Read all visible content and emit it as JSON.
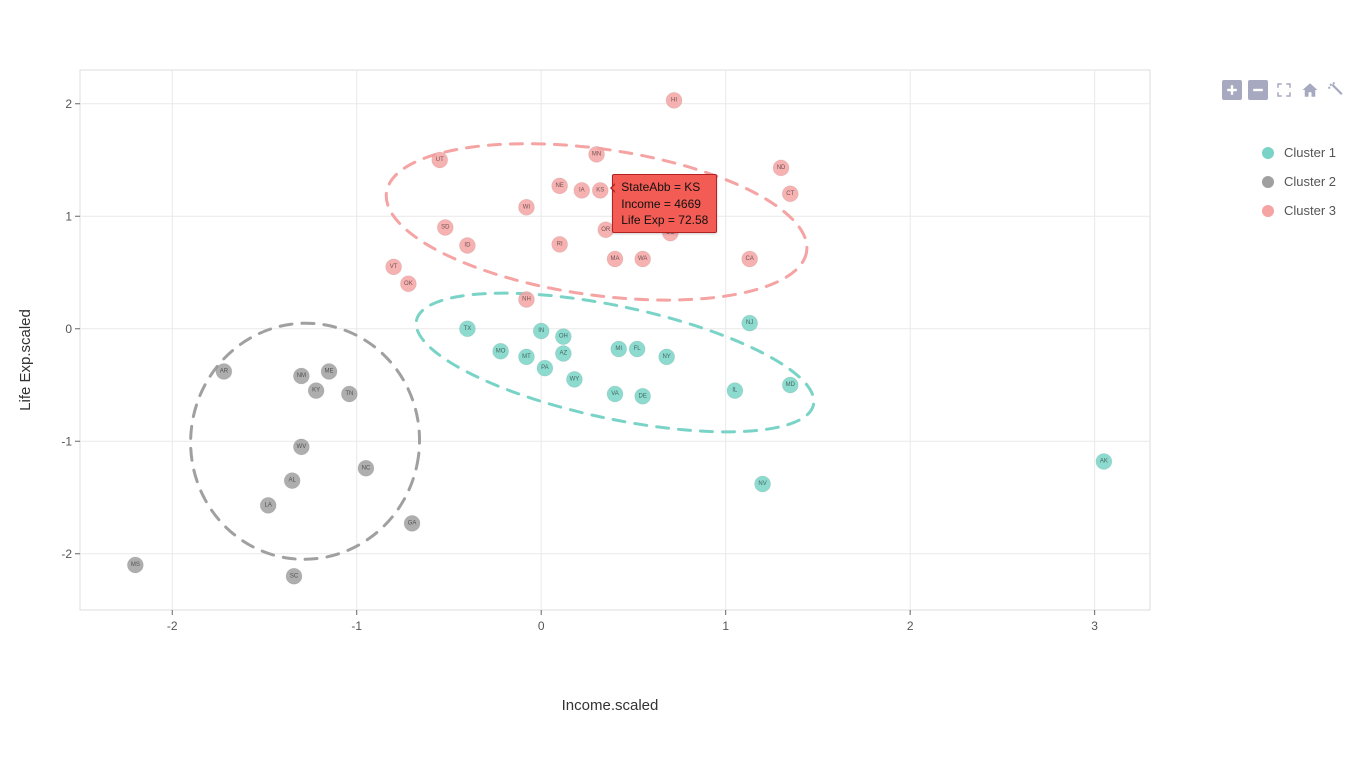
{
  "chart_data": {
    "type": "scatter",
    "xlabel": "Income.scaled",
    "ylabel": "Life Exp.scaled",
    "xlim": [
      -2.5,
      3.3
    ],
    "ylim": [
      -2.5,
      2.3
    ],
    "xticks": [
      -2,
      -1,
      0,
      1,
      2,
      3
    ],
    "yticks": [
      -2,
      -1,
      0,
      1,
      2
    ],
    "legend": [
      "Cluster 1",
      "Cluster 2",
      "Cluster 3"
    ],
    "colors": {
      "Cluster 1": "#79d4c7",
      "Cluster 2": "#a0a0a0",
      "Cluster 3": "#f5a3a3"
    },
    "ellipses": [
      {
        "cluster": "Cluster 1",
        "cx": 0.4,
        "cy": -0.3,
        "rx": 1.1,
        "ry": 0.5,
        "angle": -12
      },
      {
        "cluster": "Cluster 2",
        "cx": -1.28,
        "cy": -1.0,
        "rx": 0.62,
        "ry": 1.05,
        "angle": -8
      },
      {
        "cluster": "Cluster 3",
        "cx": 0.3,
        "cy": 0.95,
        "rx": 1.15,
        "ry": 0.65,
        "angle": -8
      }
    ],
    "series": [
      {
        "name": "Cluster 1",
        "points": [
          {
            "abb": "TX",
            "x": -0.4,
            "y": 0.0
          },
          {
            "abb": "MO",
            "x": -0.22,
            "y": -0.2
          },
          {
            "abb": "IN",
            "x": 0.0,
            "y": -0.02
          },
          {
            "abb": "MT",
            "x": -0.08,
            "y": -0.25
          },
          {
            "abb": "PA",
            "x": 0.02,
            "y": -0.35
          },
          {
            "abb": "OH",
            "x": 0.12,
            "y": -0.07
          },
          {
            "abb": "AZ",
            "x": 0.12,
            "y": -0.22
          },
          {
            "abb": "WY",
            "x": 0.18,
            "y": -0.45
          },
          {
            "abb": "MI",
            "x": 0.42,
            "y": -0.18
          },
          {
            "abb": "FL",
            "x": 0.52,
            "y": -0.18
          },
          {
            "abb": "VA",
            "x": 0.4,
            "y": -0.58
          },
          {
            "abb": "DE",
            "x": 0.55,
            "y": -0.6
          },
          {
            "abb": "NY",
            "x": 0.68,
            "y": -0.25
          },
          {
            "abb": "IL",
            "x": 1.05,
            "y": -0.55
          },
          {
            "abb": "NJ",
            "x": 1.13,
            "y": 0.05
          },
          {
            "abb": "MD",
            "x": 1.35,
            "y": -0.5
          },
          {
            "abb": "NV",
            "x": 1.2,
            "y": -1.38
          },
          {
            "abb": "AK",
            "x": 3.05,
            "y": -1.18
          }
        ]
      },
      {
        "name": "Cluster 2",
        "points": [
          {
            "abb": "AR",
            "x": -1.72,
            "y": -0.38
          },
          {
            "abb": "NM",
            "x": -1.3,
            "y": -0.42
          },
          {
            "abb": "ME",
            "x": -1.15,
            "y": -0.38
          },
          {
            "abb": "KY",
            "x": -1.22,
            "y": -0.55
          },
          {
            "abb": "TN",
            "x": -1.04,
            "y": -0.58
          },
          {
            "abb": "WV",
            "x": -1.3,
            "y": -1.05
          },
          {
            "abb": "NC",
            "x": -0.95,
            "y": -1.24
          },
          {
            "abb": "AL",
            "x": -1.35,
            "y": -1.35
          },
          {
            "abb": "LA",
            "x": -1.48,
            "y": -1.57
          },
          {
            "abb": "GA",
            "x": -0.7,
            "y": -1.73
          },
          {
            "abb": "SC",
            "x": -1.34,
            "y": -2.2
          },
          {
            "abb": "MS",
            "x": -2.2,
            "y": -2.1
          }
        ]
      },
      {
        "name": "Cluster 3",
        "points": [
          {
            "abb": "UT",
            "x": -0.55,
            "y": 1.5
          },
          {
            "abb": "ND",
            "x": 1.3,
            "y": 1.43
          },
          {
            "abb": "HI",
            "x": 0.72,
            "y": 2.03
          },
          {
            "abb": "MN",
            "x": 0.3,
            "y": 1.55
          },
          {
            "abb": "NE",
            "x": 0.1,
            "y": 1.27
          },
          {
            "abb": "IA",
            "x": 0.22,
            "y": 1.23
          },
          {
            "abb": "KS",
            "x": 0.32,
            "y": 1.23
          },
          {
            "abb": "WI",
            "x": -0.08,
            "y": 1.08
          },
          {
            "abb": "CT",
            "x": 1.35,
            "y": 1.2
          },
          {
            "abb": "SD",
            "x": -0.52,
            "y": 0.9
          },
          {
            "abb": "ID",
            "x": -0.4,
            "y": 0.74
          },
          {
            "abb": "OR",
            "x": 0.35,
            "y": 0.88
          },
          {
            "abb": "CO",
            "x": 0.7,
            "y": 0.85
          },
          {
            "abb": "RI",
            "x": 0.1,
            "y": 0.75
          },
          {
            "abb": "MA",
            "x": 0.4,
            "y": 0.62
          },
          {
            "abb": "WA",
            "x": 0.55,
            "y": 0.62
          },
          {
            "abb": "CA",
            "x": 1.13,
            "y": 0.62
          },
          {
            "abb": "VT",
            "x": -0.8,
            "y": 0.55
          },
          {
            "abb": "OK",
            "x": -0.72,
            "y": 0.4
          },
          {
            "abb": "NH",
            "x": -0.08,
            "y": 0.26
          }
        ]
      }
    ],
    "tooltip": {
      "point_abb": "KS",
      "lines": [
        "StateAbb = KS",
        "Income = 4669",
        "Life Exp = 72.58"
      ]
    }
  },
  "toolbar": {
    "zoom_in": "Zoom in",
    "zoom_out": "Zoom out",
    "fit": "Fit",
    "home": "Home",
    "more": "More"
  }
}
